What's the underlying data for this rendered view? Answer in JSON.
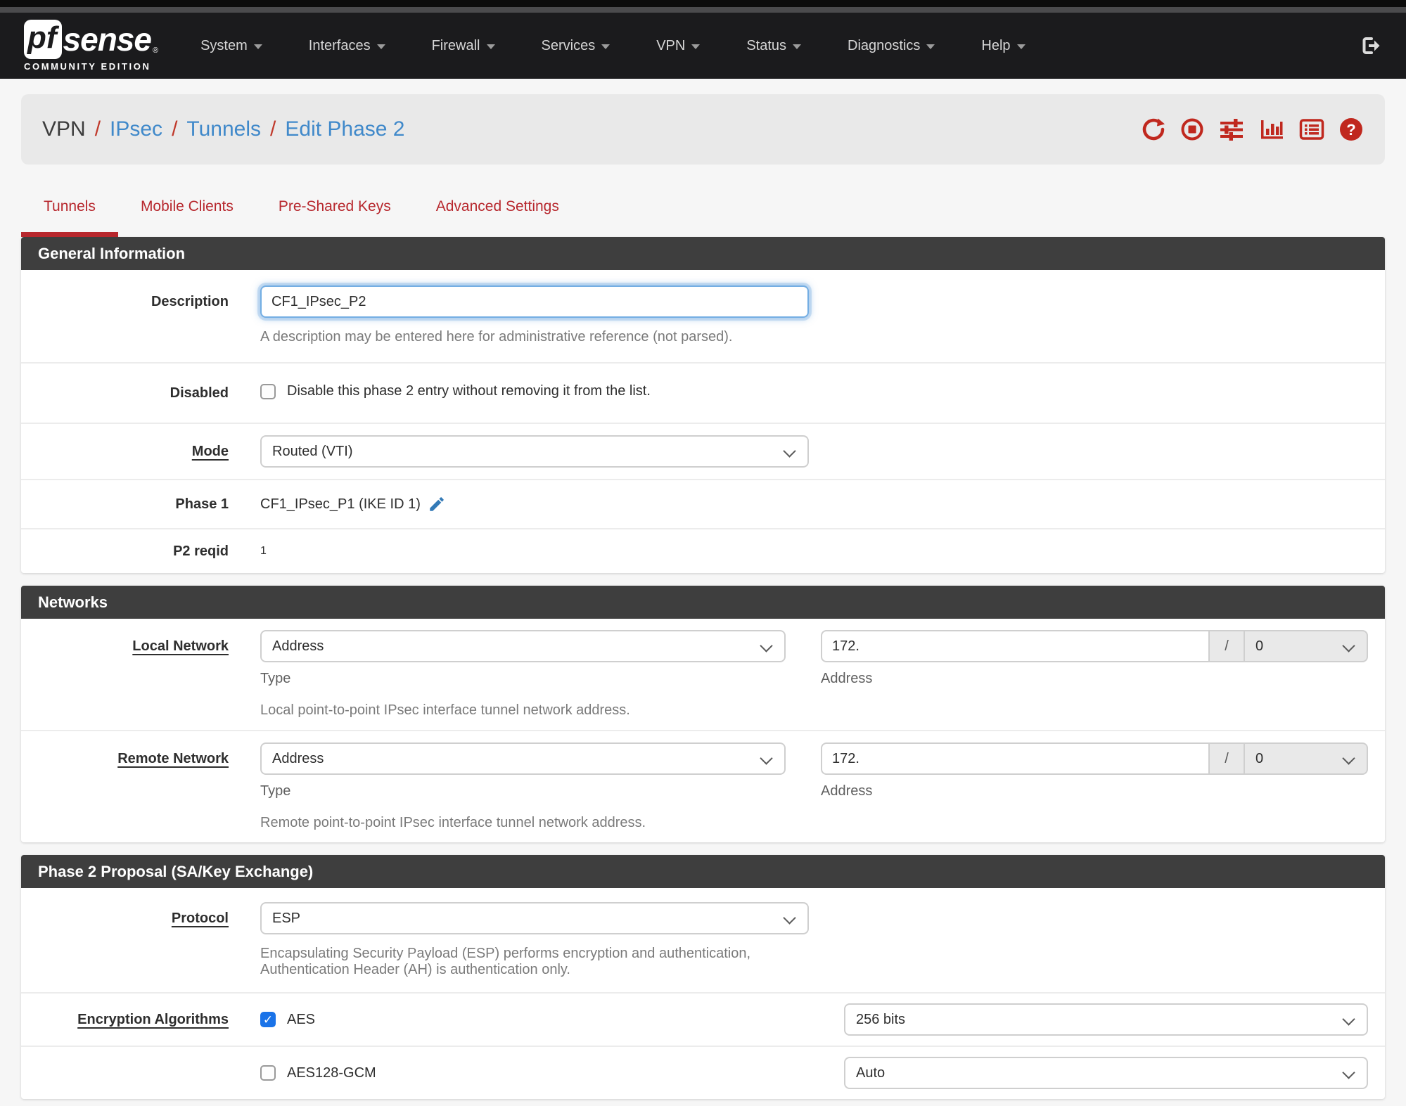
{
  "brand": {
    "pf": "pf",
    "sense": "sense",
    "reg": "®",
    "edition": "COMMUNITY EDITION"
  },
  "navbar": {
    "items": [
      {
        "label": "System"
      },
      {
        "label": "Interfaces"
      },
      {
        "label": "Firewall"
      },
      {
        "label": "Services"
      },
      {
        "label": "VPN"
      },
      {
        "label": "Status"
      },
      {
        "label": "Diagnostics"
      },
      {
        "label": "Help"
      }
    ],
    "logout_icon": "sign-out-icon"
  },
  "breadcrumb": {
    "root": "VPN",
    "separator": "/",
    "links": [
      {
        "label": "IPsec"
      },
      {
        "label": "Tunnels"
      },
      {
        "label": "Edit Phase 2"
      }
    ]
  },
  "toolbar": {
    "icons": [
      "refresh-icon",
      "stop-icon",
      "sliders-icon",
      "status-chart-icon",
      "log-icon",
      "help-icon"
    ]
  },
  "tabs": [
    {
      "label": "Tunnels",
      "active": true
    },
    {
      "label": "Mobile Clients",
      "active": false
    },
    {
      "label": "Pre-Shared Keys",
      "active": false
    },
    {
      "label": "Advanced Settings",
      "active": false
    }
  ],
  "general": {
    "title": "General Information",
    "description": {
      "label": "Description",
      "value": "CF1_IPsec_P2",
      "help": "A description may be entered here for administrative reference (not parsed)."
    },
    "disabled": {
      "label": "Disabled",
      "checkbox_label": "Disable this phase 2 entry without removing it from the list.",
      "checked": false
    },
    "mode": {
      "label": "Mode",
      "value": "Routed (VTI)"
    },
    "phase1": {
      "label": "Phase 1",
      "value": "CF1_IPsec_P1 (IKE ID 1)",
      "edit_icon": "pencil-icon"
    },
    "p2reqid": {
      "label": "P2 reqid",
      "value": "1"
    }
  },
  "networks": {
    "title": "Networks",
    "local": {
      "label": "Local Network",
      "type_value": "Address",
      "type_caption": "Type",
      "address_value": "172.",
      "address_caption": "Address",
      "mask_separator": "/",
      "mask_value": "0",
      "help": "Local point-to-point IPsec interface tunnel network address."
    },
    "remote": {
      "label": "Remote Network",
      "type_value": "Address",
      "type_caption": "Type",
      "address_value": "172.",
      "address_caption": "Address",
      "mask_separator": "/",
      "mask_value": "0",
      "help": "Remote point-to-point IPsec interface tunnel network address."
    }
  },
  "proposal": {
    "title": "Phase 2 Proposal (SA/Key Exchange)",
    "protocol": {
      "label": "Protocol",
      "value": "ESP",
      "help": "Encapsulating Security Payload (ESP) performs encryption and authentication, Authentication Header (AH) is authentication only."
    },
    "encryption": {
      "label": "Encryption Algorithms",
      "algorithms": [
        {
          "name": "AES",
          "checked": true,
          "key_value": "256 bits"
        },
        {
          "name": "AES128-GCM",
          "checked": false,
          "key_value": "Auto"
        }
      ]
    }
  },
  "colors": {
    "accent_red": "#c0281e",
    "tab_red": "#b7272d",
    "link_blue": "#4089ca",
    "checkbox_blue": "#1a73e8",
    "section_header_bg": "#3e3e3e"
  }
}
